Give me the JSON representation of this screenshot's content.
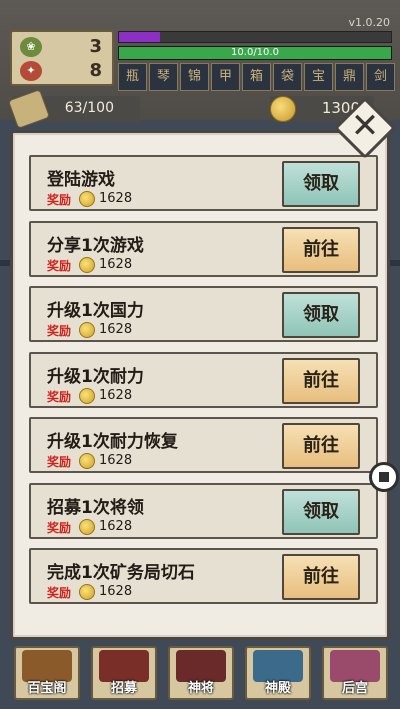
{
  "app": {
    "version": "v1.0.20"
  },
  "hud": {
    "stat_leaf": "3",
    "stat_seal": "8",
    "purple_bar_fraction": 0.15,
    "health_text": "10.0/10.0",
    "health_fraction": 1.0,
    "equipment": [
      "瓶",
      "琴",
      "锦",
      "甲",
      "箱",
      "袋",
      "宝",
      "鼎",
      "剑"
    ],
    "scroll_text": "63/100",
    "coins": "1300"
  },
  "tasks": [
    {
      "title": "登陆游戏",
      "reward_label": "奖励",
      "reward": "1628",
      "button": "领取",
      "kind": "claim"
    },
    {
      "title": "分享1次游戏",
      "reward_label": "奖励",
      "reward": "1628",
      "button": "前往",
      "kind": "go"
    },
    {
      "title": "升级1次国力",
      "reward_label": "奖励",
      "reward": "1628",
      "button": "领取",
      "kind": "claim"
    },
    {
      "title": "升级1次耐力",
      "reward_label": "奖励",
      "reward": "1628",
      "button": "前往",
      "kind": "go"
    },
    {
      "title": "升级1次耐力恢复",
      "reward_label": "奖励",
      "reward": "1628",
      "button": "前往",
      "kind": "go"
    },
    {
      "title": "招募1次将领",
      "reward_label": "奖励",
      "reward": "1628",
      "button": "领取",
      "kind": "claim"
    },
    {
      "title": "完成1次矿务局切石",
      "reward_label": "奖励",
      "reward": "1628",
      "button": "前往",
      "kind": "go"
    }
  ],
  "nav": [
    {
      "label": "百宝阁",
      "color": "#8a5a2a"
    },
    {
      "label": "招募",
      "color": "#7a2e28"
    },
    {
      "label": "神将",
      "color": "#6b2a2a"
    },
    {
      "label": "神殿",
      "color": "#3b6a8a"
    },
    {
      "label": "后宫",
      "color": "#9a4a6a"
    }
  ],
  "colors": {
    "claim_button": "#a8d4ca",
    "go_button": "#eecb8c",
    "reward_label": "#d0221a",
    "purple_bar": "#8b2fc7",
    "health_bar": "#39a84a"
  }
}
